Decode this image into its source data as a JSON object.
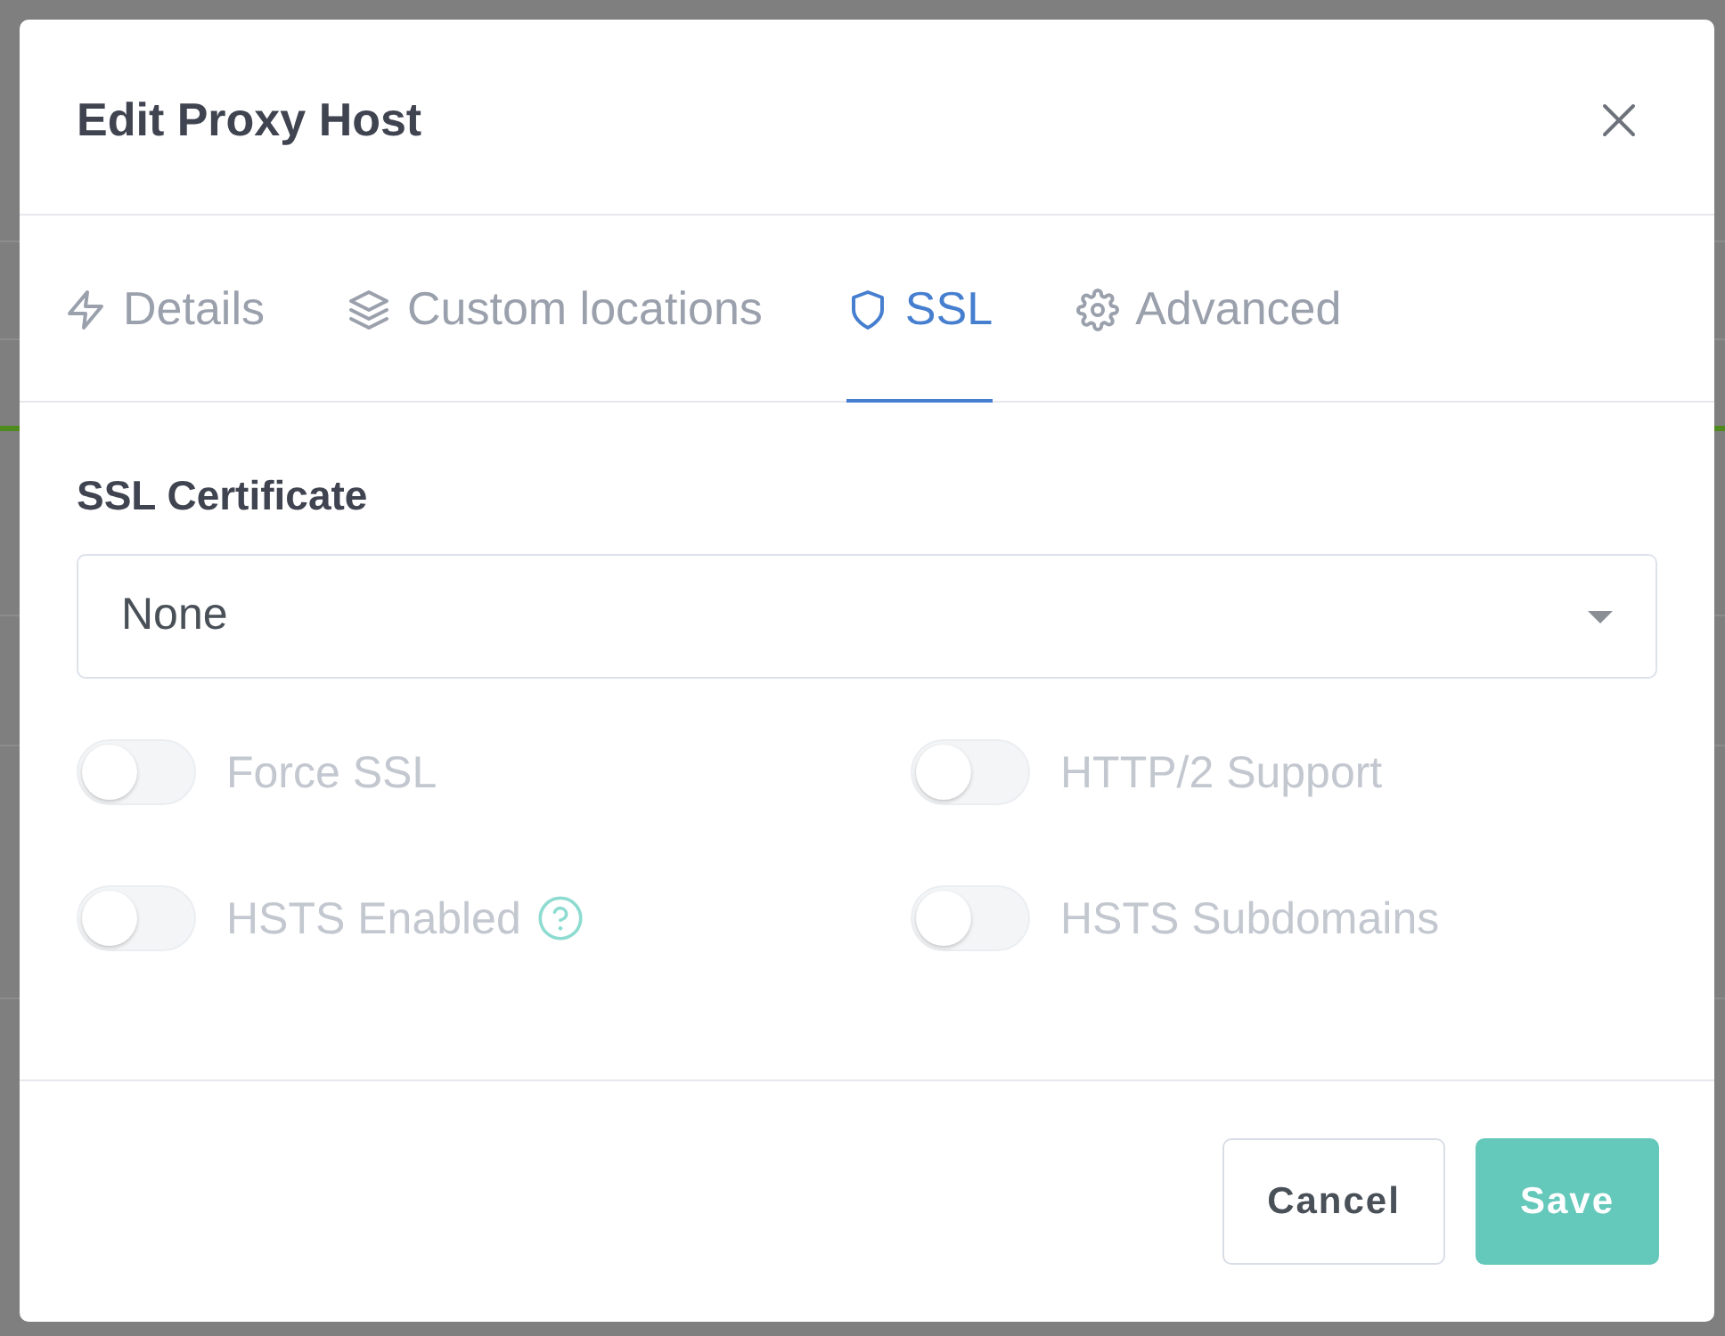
{
  "dialog": {
    "title": "Edit Proxy Host"
  },
  "tabs": [
    {
      "label": "Details",
      "selected": false
    },
    {
      "label": "Custom locations",
      "selected": false
    },
    {
      "label": "SSL",
      "selected": true
    },
    {
      "label": "Advanced",
      "selected": false
    }
  ],
  "ssl_certificate": {
    "label": "SSL Certificate",
    "value": "None"
  },
  "options": [
    {
      "label": "Force SSL",
      "on": false,
      "disabled": true
    },
    {
      "label": "HTTP/2 Support",
      "on": false,
      "disabled": true
    },
    {
      "label": "HSTS Enabled",
      "on": false,
      "disabled": true,
      "help": true
    },
    {
      "label": "HSTS Subdomains",
      "on": false,
      "disabled": true
    }
  ],
  "buttons": [
    {
      "label": "Cancel",
      "kind": "secondary"
    },
    {
      "label": "Save",
      "kind": "primary"
    }
  ]
}
